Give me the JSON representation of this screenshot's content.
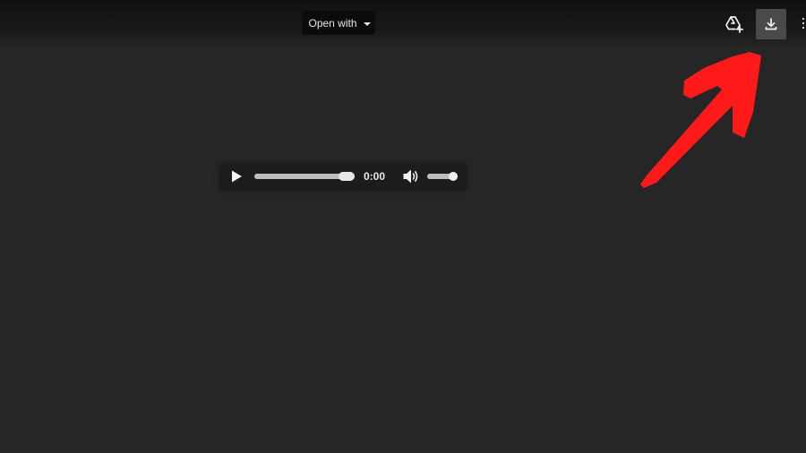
{
  "toolbar": {
    "open_with_label": "Open with",
    "add_to_drive_icon": "add-to-drive-icon",
    "download_icon": "download-icon"
  },
  "player": {
    "time": "0:00",
    "progress_fraction": 1.0,
    "volume_fraction": 1.0,
    "play_icon": "play-icon",
    "volume_icon": "volume-icon"
  },
  "annotation": {
    "arrow_color": "#ff1a1a"
  },
  "colors": {
    "background": "#262626",
    "download_button_bg": "#4a4a4a"
  }
}
